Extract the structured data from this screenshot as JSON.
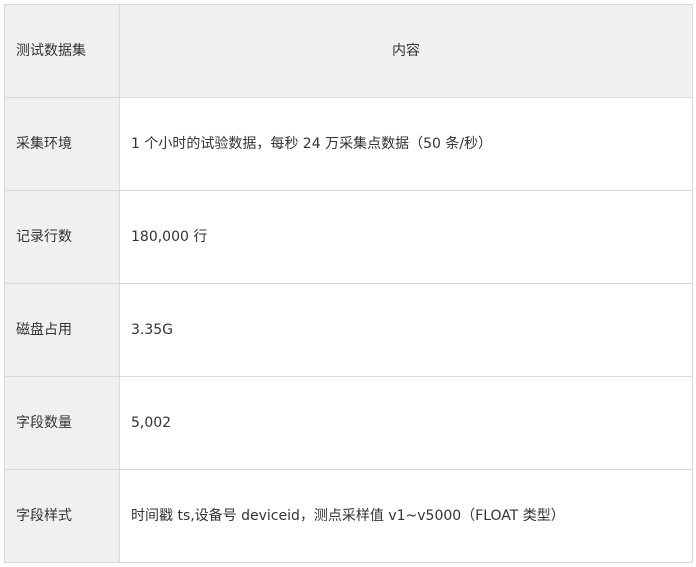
{
  "table": {
    "headers": [
      "测试数据集",
      "内容"
    ],
    "rows": [
      {
        "label": "采集环境",
        "value": "1 个小时的试验数据，每秒 24 万采集点数据（50 条/秒）"
      },
      {
        "label": "记录行数",
        "value": "180,000 行"
      },
      {
        "label": "磁盘占用",
        "value": "3.35G"
      },
      {
        "label": "字段数量",
        "value": "5,002"
      },
      {
        "label": "字段样式",
        "value": "时间戳 ts,设备号 deviceid，测点采样值 v1~v5000（FLOAT 类型）"
      }
    ]
  }
}
